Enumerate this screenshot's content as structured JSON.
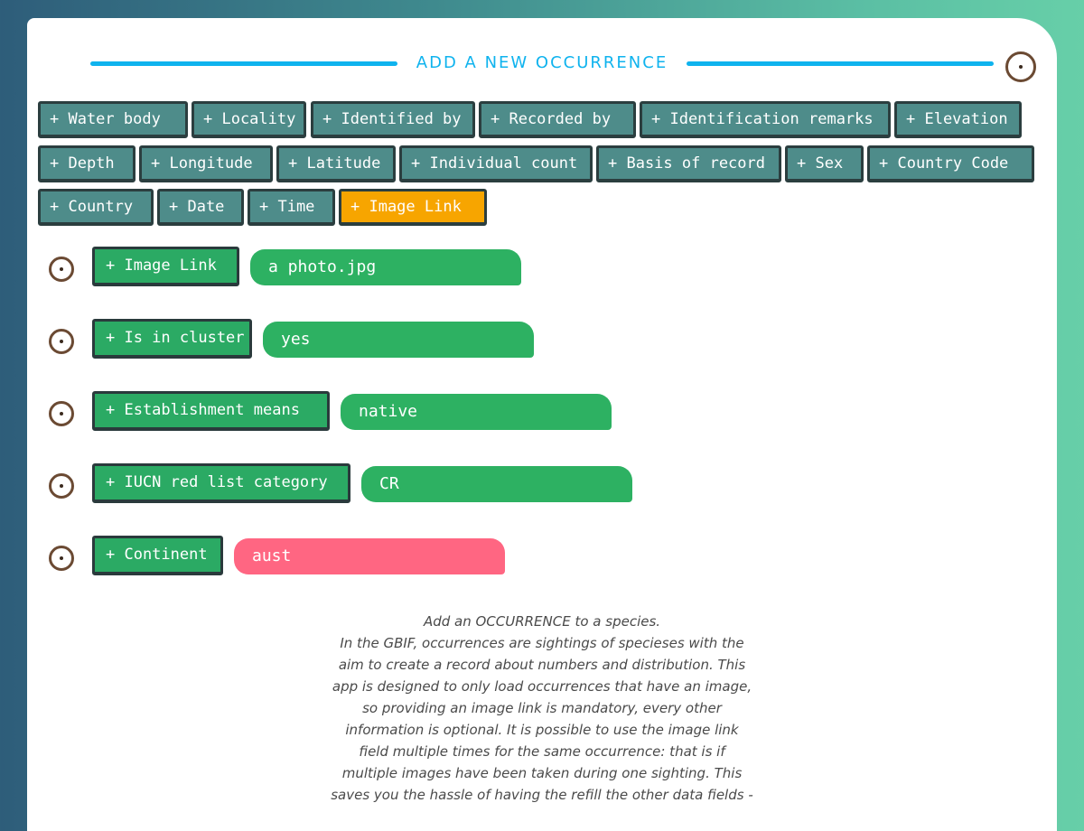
{
  "header": {
    "title": "ADD A NEW OCCURRENCE",
    "close_icon": "circle-dot-icon"
  },
  "field_chips": [
    {
      "label": "+ Water body"
    },
    {
      "label": "+ Locality"
    },
    {
      "label": "+ Identified by"
    },
    {
      "label": "+ Recorded by"
    },
    {
      "label": "+ Identification remarks"
    },
    {
      "label": "+ Elevation"
    },
    {
      "label": "+ Depth"
    },
    {
      "label": "+ Longitude"
    },
    {
      "label": "+ Latitude"
    },
    {
      "label": "+ Individual count"
    },
    {
      "label": "+ Basis of record"
    },
    {
      "label": "+ Sex"
    },
    {
      "label": "+ Country Code"
    },
    {
      "label": "+ Country"
    },
    {
      "label": "+ Date"
    },
    {
      "label": "+ Time"
    },
    {
      "label": "+ Image Link",
      "active": true
    }
  ],
  "fields": [
    {
      "label": "+ Image Link",
      "value": "a photo.jpg",
      "valid": true
    },
    {
      "label": "+ Is in cluster",
      "value": "yes",
      "valid": true
    },
    {
      "label": "+ Establishment means",
      "value": "native",
      "valid": true
    },
    {
      "label": "+ IUCN red list category",
      "value": "CR",
      "valid": true
    },
    {
      "label": "+ Continent",
      "value": "aust",
      "valid": false
    }
  ],
  "description": {
    "lines": [
      "Add an OCCURRENCE to a species.",
      "In the GBIF, occurrences are sightings of specieses with the",
      "aim to create a record about numbers and distribution. This",
      "app is designed to only load occurrences that have an image,",
      "so providing an image link is mandatory, every other",
      "information is optional. It is possible to use the image link",
      "field multiple times for the same occurrence: that is if",
      "multiple images have been taken during one sighting. This",
      "saves you the hassle of having the refill the other data fields -"
    ]
  },
  "colors": {
    "accent": "#0fb3ee",
    "chip": "#4e8c8a",
    "chip_active": "#f7a500",
    "field_valid": "#2db162",
    "field_invalid": "#ff6682",
    "remove_icon": "#6b4a33"
  }
}
